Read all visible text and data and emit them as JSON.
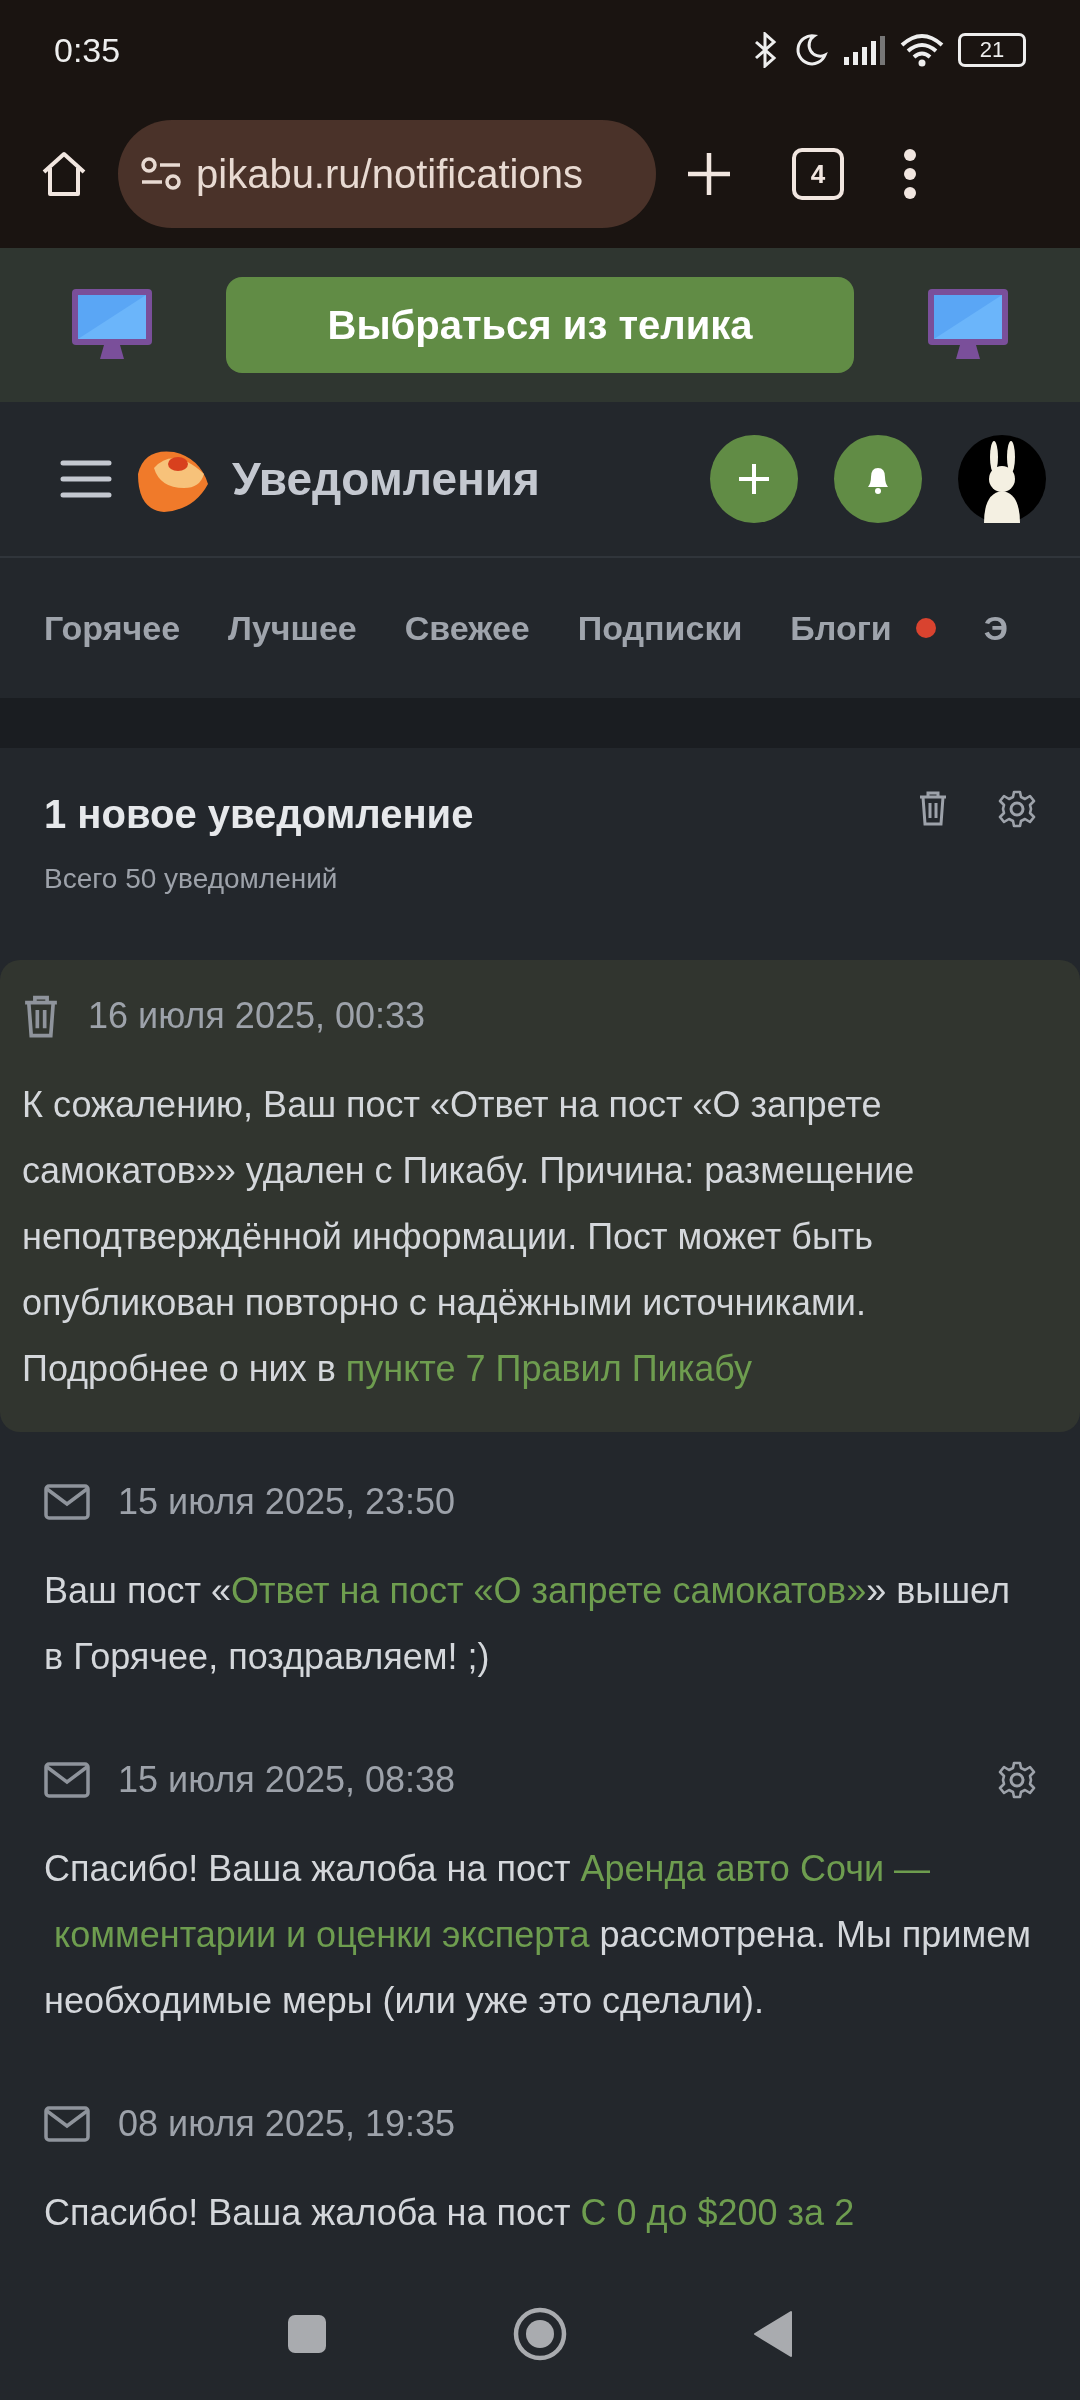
{
  "status_bar": {
    "time": "0:35",
    "battery": "21"
  },
  "browser": {
    "url": "pikabu.ru/notifications",
    "tab_count": "4"
  },
  "banner": {
    "button": "Выбраться из телика"
  },
  "header": {
    "title": "Уведомления"
  },
  "tabs": [
    {
      "label": "Горячее",
      "dot": false
    },
    {
      "label": "Лучшее",
      "dot": false
    },
    {
      "label": "Свежее",
      "dot": false
    },
    {
      "label": "Подписки",
      "dot": false
    },
    {
      "label": "Блоги",
      "dot": true
    },
    {
      "label": "Э",
      "dot": false
    }
  ],
  "summary": {
    "title": "1 новое уведомление",
    "subtitle": "Всего 50 уведомлений"
  },
  "notifications": [
    {
      "kind": "deleted",
      "unread": true,
      "settings": false,
      "date": "16 июля 2025, 00:33",
      "parts": [
        {
          "text": "К сожалению, Ваш пост «Ответ на пост «О запрете самокатов»» удален с Пикабу. Причина: размещение неподтверждённой информации. Пост может быть опубликован повторно с надёжными источниками. Подробнее о них в ",
          "link": false
        },
        {
          "text": "пункте 7 Правил Пикабу",
          "link": true
        }
      ]
    },
    {
      "kind": "message",
      "unread": false,
      "settings": false,
      "date": "15 июля 2025, 23:50",
      "parts": [
        {
          "text": "Ваш пост «",
          "link": false
        },
        {
          "text": "Ответ на пост «О запрете самокатов»",
          "link": true
        },
        {
          "text": "» вышел в Горячее, поздравляем! ;)",
          "link": false
        }
      ]
    },
    {
      "kind": "message",
      "unread": false,
      "settings": true,
      "date": "15 июля 2025, 08:38",
      "parts": [
        {
          "text": "Спасибо! Ваша жалоба на пост ",
          "link": false
        },
        {
          "text": "Аренда авто Сочи —",
          "link": true
        },
        {
          "text": "комментарии и оценки эксперта",
          "link": true
        },
        {
          "text": " рассмотрена. Мы примем необходимые меры (или уже это сделали).",
          "link": false
        }
      ]
    },
    {
      "kind": "message",
      "unread": false,
      "settings": false,
      "date": "08 июля 2025, 19:35",
      "parts": [
        {
          "text": "Спасибо! Ваша жалоба на пост ",
          "link": false
        },
        {
          "text": "С 0 до $200 за 2",
          "link": true
        }
      ]
    }
  ]
}
